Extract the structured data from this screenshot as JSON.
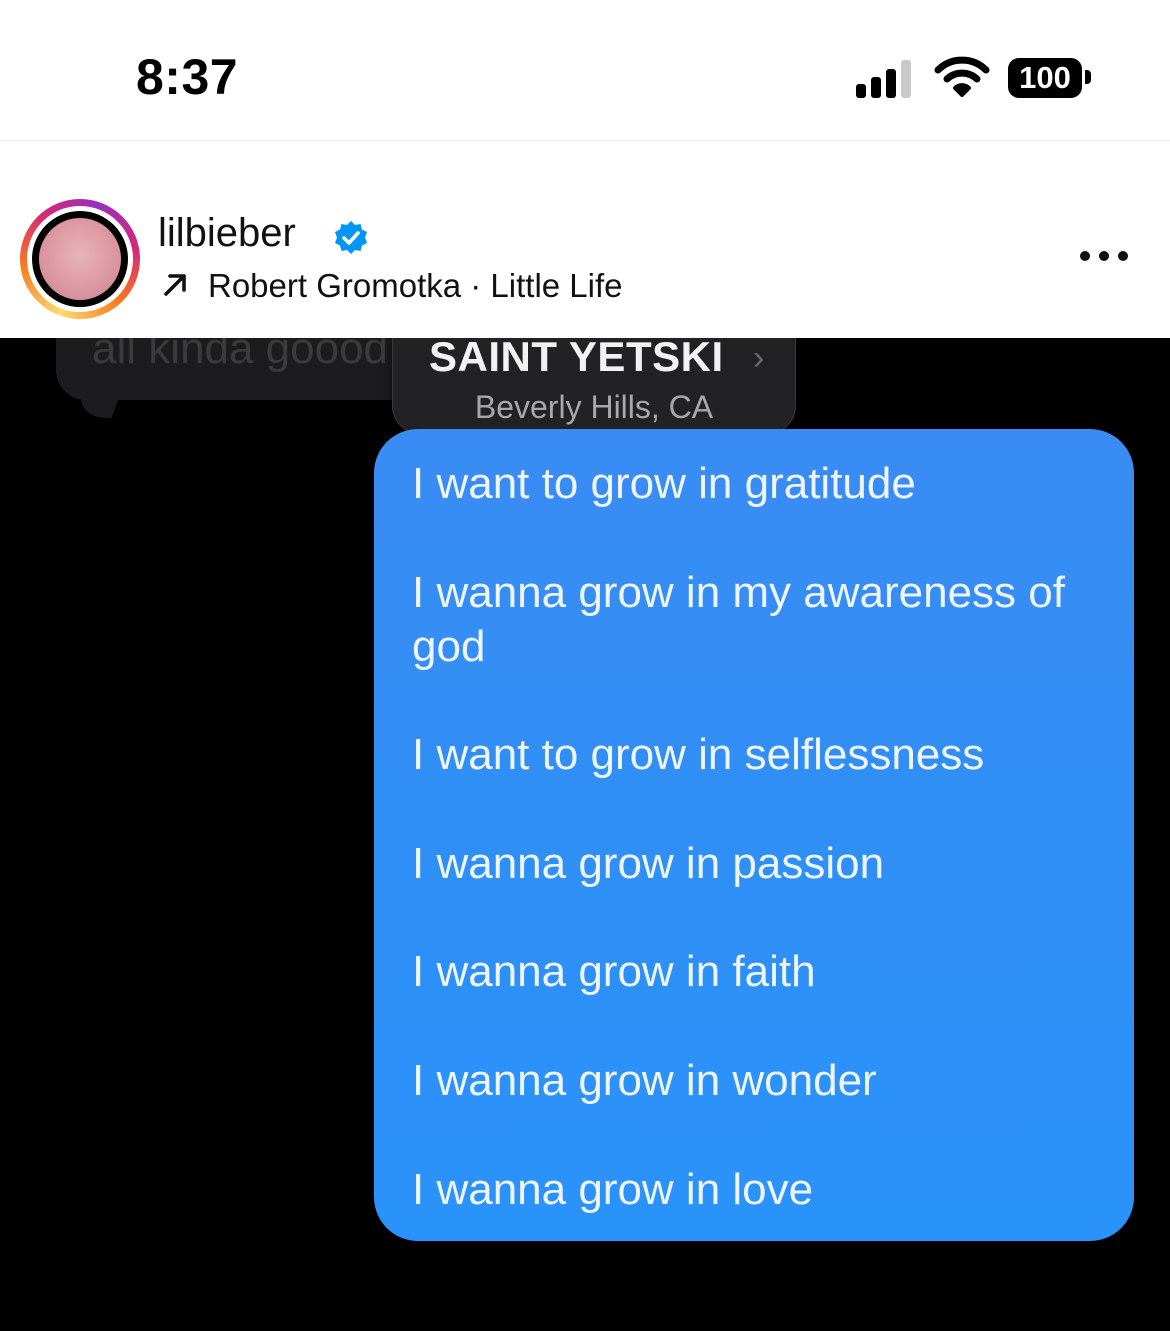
{
  "status_bar": {
    "time": "8:37",
    "battery": "100"
  },
  "post": {
    "username": "lilbieber",
    "verified": true,
    "subtitle": "Robert Gromotka · Little Life",
    "icons": [
      "verified-badge-icon",
      "arrow-up-right-icon",
      "more-options-icon"
    ]
  },
  "media": {
    "grey_message": "all kinda goood",
    "notification": {
      "title": "SAINT YETSKI",
      "subtitle": "Beverly Hills, CA"
    },
    "blue_message_lines": [
      "I want to grow in gratitude",
      "I wanna grow in my awareness of god",
      "I want to grow in selflessness",
      "I wanna grow in passion",
      "I wanna grow in faith",
      "I wanna grow in wonder",
      "I wanna grow in love"
    ]
  },
  "colors": {
    "bubble_blue": "#2f8ff5",
    "verified_blue": "#0095f6",
    "media_background": "#000000"
  }
}
